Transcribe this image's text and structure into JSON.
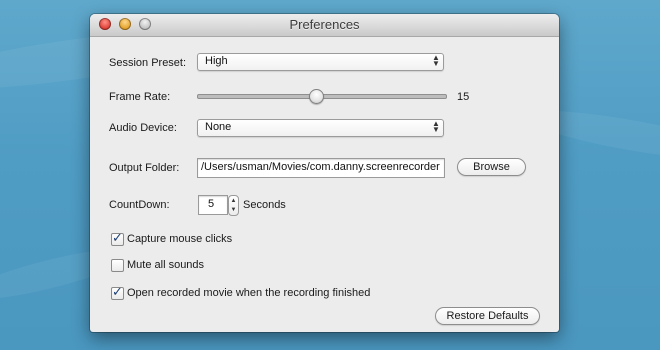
{
  "window": {
    "title": "Preferences"
  },
  "session_preset": {
    "label": "Session Preset:",
    "value": "High"
  },
  "frame_rate": {
    "label": "Frame Rate:",
    "value": "15",
    "fraction": 0.48
  },
  "audio_device": {
    "label": "Audio Device:",
    "value": "None"
  },
  "output_folder": {
    "label": "Output Folder:",
    "value": "/Users/usman/Movies/com.danny.screenrecorder",
    "browse_label": "Browse"
  },
  "countdown": {
    "label": "CountDown:",
    "value": "5",
    "unit": "Seconds"
  },
  "checkboxes": [
    {
      "label": "Capture mouse clicks",
      "checked": true
    },
    {
      "label": "Mute all sounds",
      "checked": false
    },
    {
      "label": "Open recorded movie when the recording finished",
      "checked": true
    }
  ],
  "restore_defaults_label": "Restore Defaults",
  "icons": {
    "popup_arrows": "updown-arrows-icon",
    "stepper": "stepper-icon",
    "checkmark": "checkmark-icon"
  }
}
